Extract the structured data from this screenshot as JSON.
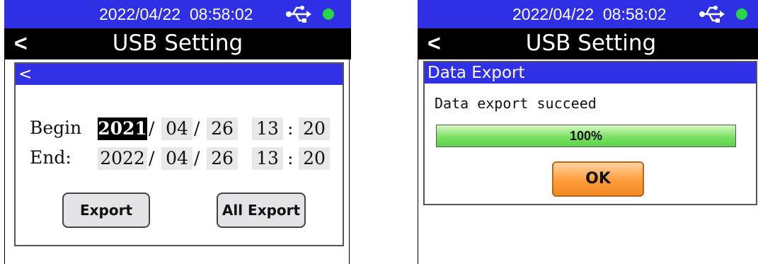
{
  "status": {
    "datetime": "2022/04/22  08:58:02",
    "usb_icon": "usb-icon",
    "indicator_color": "#27d644"
  },
  "title": {
    "back": "<",
    "text": "USB Setting"
  },
  "left": {
    "dialog_header": "<",
    "begin": {
      "label": "Begin",
      "year": "2021",
      "month": "04",
      "day": "26",
      "hour": "13",
      "minute": "20"
    },
    "end": {
      "label": "End:",
      "year": "2022",
      "month": "04",
      "day": "26",
      "hour": "13",
      "minute": "20"
    },
    "separators": {
      "date": "/",
      "time": ":"
    },
    "export_button": "Export",
    "all_export_button": "All Export"
  },
  "right": {
    "dialog_header": "Data Export",
    "message": "Data export succeed",
    "progress_percent": 100,
    "progress_label": "100%",
    "ok_button": "OK"
  },
  "colors": {
    "status_bar": "#2f2fe6",
    "title_bar": "#000000",
    "dialog_header": "#3030e6",
    "progress_fill": "#76e05f",
    "ok_button": "#ff9c3a"
  }
}
